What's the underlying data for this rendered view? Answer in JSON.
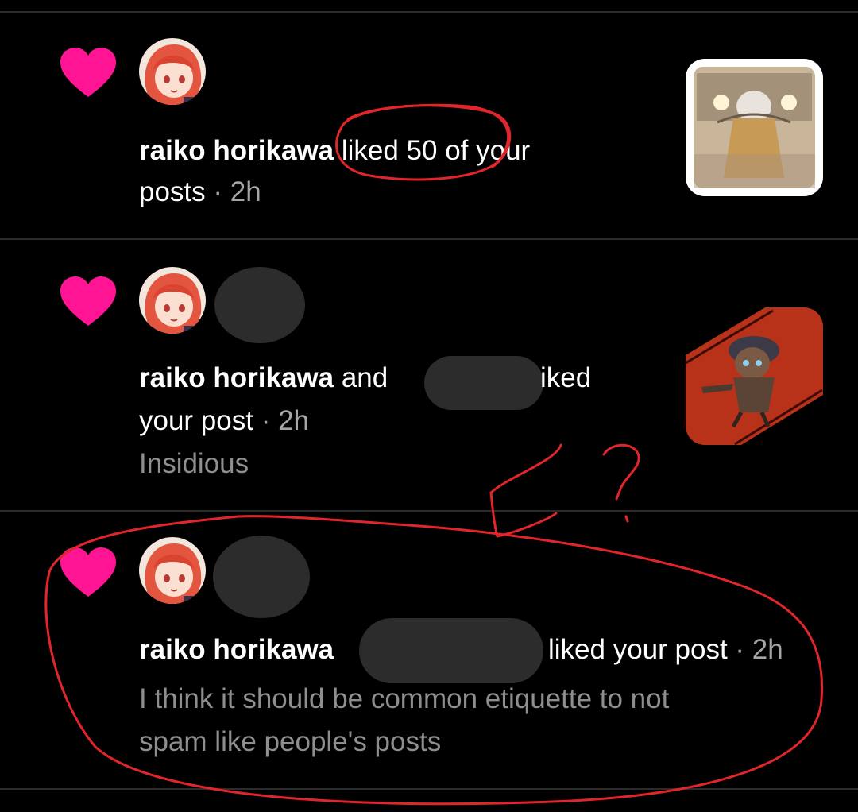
{
  "notifications": [
    {
      "user": "raiko horikawa",
      "action_rest": " liked 50 of your",
      "action_line2": "posts",
      "dot": " · ",
      "time": "2h",
      "sub": ""
    },
    {
      "user": "raiko horikawa",
      "action_rest": " and",
      "action_tail": "iked",
      "action_line2": "your post",
      "dot": " · ",
      "time": "2h",
      "sub": "Insidious"
    },
    {
      "user": "raiko horikawa",
      "action_tail": "liked your post",
      "dot": " · ",
      "time": "2h",
      "sub_line1": "I think it should be common etiquette to not",
      "sub_line2": "spam like people's posts"
    }
  ],
  "colors": {
    "heart": "#ff1493",
    "scribble": "#e0262a",
    "background": "#000000",
    "secondary_text": "#8e8e8e"
  },
  "icons": {
    "like": "heart-icon"
  },
  "annotations": {
    "question_mark": "?"
  }
}
